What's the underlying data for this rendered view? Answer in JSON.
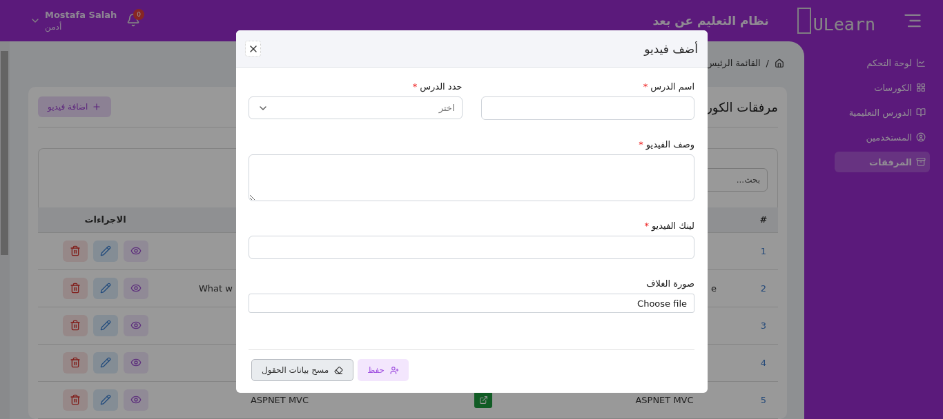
{
  "header": {
    "logo": "ULearn",
    "title": "نظام التعليم عن بعد",
    "user": {
      "name": "Mostafa Salah",
      "role": "أدمن",
      "notifications": "0"
    }
  },
  "sidebar": {
    "items": [
      {
        "label": "لوحة التحكم",
        "selected": false
      },
      {
        "label": "الكورسات",
        "selected": false
      },
      {
        "label": "الدورس التعليمية",
        "selected": false
      },
      {
        "label": "المستخدمين",
        "selected": false
      },
      {
        "label": "المرفقات",
        "selected": true
      }
    ]
  },
  "breadcrumb": {
    "separator": "/",
    "items": [
      "القائمة الرئيس"
    ]
  },
  "card": {
    "title": "مرفقات الكور",
    "add_button": "اضافة فيديو",
    "search": {
      "placeholder": "بحث..."
    }
  },
  "table": {
    "columns": [
      "#",
      "الاجراءات"
    ],
    "rows": [
      {
        "number": "1",
        "link_button": false
      },
      {
        "number": "2",
        "column_2": "e",
        "column_4": "What w",
        "link_button": false
      },
      {
        "number": "3",
        "link_button": false
      },
      {
        "number": "4",
        "link_button": false
      },
      {
        "number": "5",
        "column_2": "ASPNET MVC",
        "column_4": "ASPNET MVC",
        "link_button": true
      }
    ]
  },
  "modal": {
    "title": "أضف فيديو",
    "fields": [
      {
        "kind": "text",
        "label": "اسم الدرس",
        "required_mark": "*"
      },
      {
        "kind": "select",
        "label": "حدد الدرس",
        "required_mark": "*",
        "placeholder": "اختر"
      },
      {
        "kind": "textarea",
        "label": "وصف الفيديو",
        "required_mark": "*"
      },
      {
        "kind": "text",
        "label": "لينك الفيديو",
        "required_mark": "*"
      },
      {
        "kind": "file",
        "label": "صورة الغلاف",
        "value": "Choose file"
      }
    ],
    "buttons": [
      {
        "kind": "save",
        "label": "حفظ"
      },
      {
        "kind": "clear",
        "label": "مسح بيانات الحقول"
      }
    ]
  }
}
